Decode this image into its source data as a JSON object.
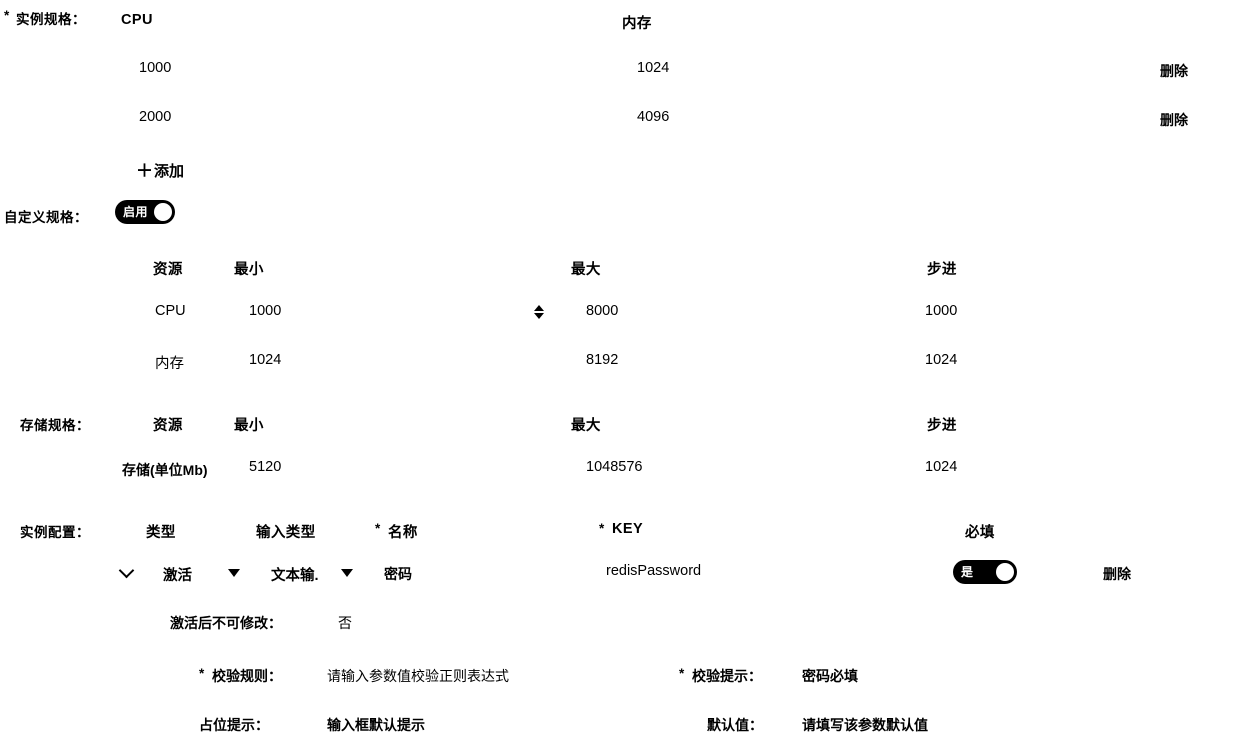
{
  "instance_spec": {
    "label": "实例规格：",
    "required_mark": "*",
    "columns": [
      "CPU",
      "内存"
    ],
    "rows": [
      {
        "cpu": "1000",
        "memory": "1024",
        "delete_label": "删除"
      },
      {
        "cpu": "2000",
        "memory": "4096",
        "delete_label": "删除"
      }
    ],
    "add_button": {
      "icon": "plus-icon",
      "label": "添加"
    }
  },
  "custom_spec": {
    "label": "自定义规格：",
    "toggle": {
      "state_label": "启用",
      "enabled": true
    },
    "columns": [
      "资源",
      "最小",
      "最大",
      "步进"
    ],
    "rows": [
      {
        "resource": "CPU",
        "min": "1000",
        "max": "8000",
        "step": "1000",
        "has_stepper": true
      },
      {
        "resource": "内存",
        "min": "1024",
        "max": "8192",
        "step": "1024",
        "has_stepper": false
      }
    ]
  },
  "storage_spec": {
    "label": "存储规格：",
    "columns": [
      "资源",
      "最小",
      "最大",
      "步进"
    ],
    "rows": [
      {
        "resource": "存储(单位Mb)",
        "min": "5120",
        "max": "1048576",
        "step": "1024"
      }
    ]
  },
  "instance_config": {
    "label": "实例配置：",
    "columns": [
      {
        "label": "类型",
        "required_mark": ""
      },
      {
        "label": "输入类型",
        "required_mark": ""
      },
      {
        "label": "名称",
        "required_mark": "*"
      },
      {
        "label": "KEY",
        "required_mark": "*"
      },
      {
        "label": "必填",
        "required_mark": ""
      }
    ],
    "row": {
      "expand_icon": "chevron-down-icon",
      "type_value": "激活",
      "type_caret": "caret-down-icon",
      "input_type_value": "文本输入",
      "input_type_value_display": "文本输.",
      "input_type_caret": "caret-down-icon",
      "name_value": "密码",
      "key_value": "redisPassword",
      "required_toggle": {
        "state_label": "是",
        "enabled": true
      },
      "delete_label": "删除"
    },
    "detail": {
      "immutable_label": "激活后不可修改：",
      "immutable_value": "否",
      "validate_rule_label": "校验规则：",
      "validate_rule_required_mark": "*",
      "validate_rule_placeholder": "请输入参数值校验正则表达式",
      "validate_tip_label": "校验提示：",
      "validate_tip_required_mark": "*",
      "validate_tip_value": "密码必填",
      "placeholder_label": "占位提示：",
      "placeholder_value": "输入框默认提示",
      "default_value_label": "默认值：",
      "default_value_placeholder": "请填写该参数默认值"
    }
  },
  "colors": {
    "text": "#000000",
    "background": "#ffffff",
    "toggle_on": "#000000",
    "toggle_knob": "#ffffff"
  }
}
